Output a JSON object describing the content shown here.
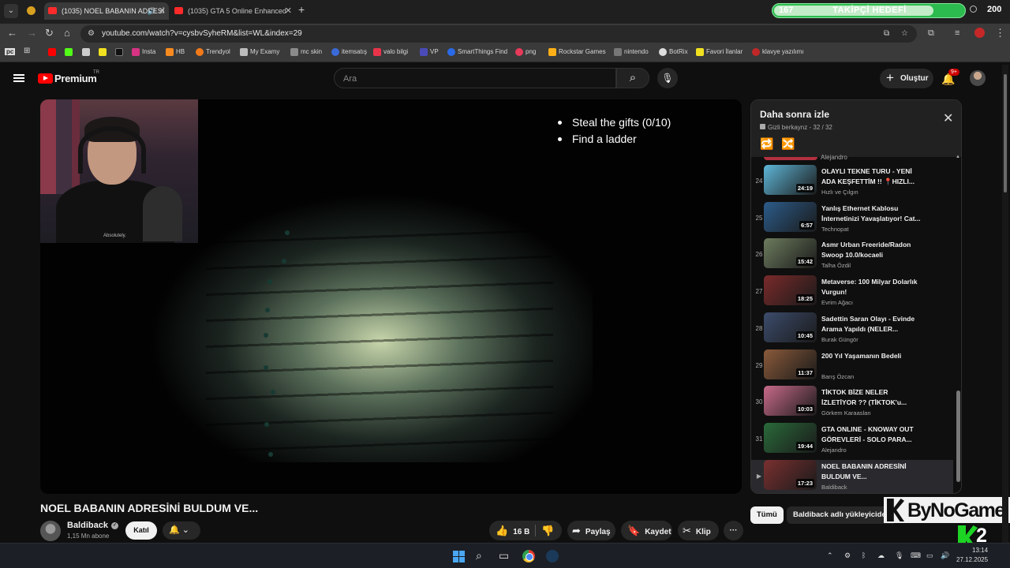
{
  "browser": {
    "tabs": [
      {
        "title": "(1035) NOEL BABANIN ADRESİ",
        "active": true
      },
      {
        "title": "(1035) GTA 5 Online Enhanced",
        "active": false
      }
    ],
    "follower_goal": {
      "current": "167",
      "title": "TAKİPÇİ HEDEFİ",
      "target": "200",
      "progress": 0.835
    },
    "url": "youtube.com/watch?v=cysbvSyheRM&list=WL&index=29",
    "bookmarks": [
      "Insta",
      "HB",
      "Trendyol",
      "My Examy",
      "mc skin",
      "itemsatış",
      "valo bilgi",
      "VP",
      "SmartThings Find",
      "png",
      "Rockstar Games",
      "nintendo",
      "BotRix",
      "Favori İlanlar",
      "klavye yazılımı"
    ]
  },
  "youtube": {
    "brand": "Premium",
    "country": "TR",
    "search_placeholder": "Ara",
    "create_label": "Oluştur",
    "notif_count": "9+"
  },
  "video": {
    "objectives": [
      "Steal the gifts   (0/10)",
      "Find a ladder"
    ],
    "webcam_shirt": "Absolutely.",
    "title": "NOEL BABANIN ADRESİNİ BULDUM VE...",
    "channel": "Baldiback",
    "subscribers": "1,15 Mn abone",
    "join_label": "Katıl",
    "likes": "16 B",
    "share_label": "Paylaş",
    "save_label": "Kaydet",
    "clip_label": "Klip",
    "more_label": "···"
  },
  "playlist": {
    "title": "Daha sonra izle",
    "privacy": "Gizli",
    "owner": "berkaynz",
    "position": "32 / 32",
    "prev_channel": "Alejandro",
    "items": [
      {
        "index": "24",
        "title": "OLAYLI TEKNE TURU - YENİ\nADA KEŞFETTİM !! 📍HIZLI...",
        "channel": "Hızlı ve Çılgın",
        "duration": "24:19",
        "color": "#5fb6d8"
      },
      {
        "index": "25",
        "title": "Yanlış Ethernet Kablosu\nİnternetinizi Yavaşlatıyor! Cat...",
        "channel": "Technopat",
        "duration": "6:57",
        "color": "#2c5c8a"
      },
      {
        "index": "26",
        "title": "Asmr Urban Freeride/Radon\nSwoop 10.0/kocaeli",
        "channel": "Talha Özdil",
        "duration": "15:42",
        "color": "#6d7c5e"
      },
      {
        "index": "27",
        "title": "Metaverse: 100 Milyar Dolarlık\nVurgun!",
        "channel": "Evrim Ağacı",
        "duration": "18:25",
        "color": "#7a2a2a"
      },
      {
        "index": "28",
        "title": "Sadettin Saran Olayı - Evinde\nArama Yapıldı (NELER...",
        "channel": "Burak Güngör",
        "duration": "10:45",
        "color": "#3c4c6c"
      },
      {
        "index": "29",
        "title": "200 Yıl Yaşamanın Bedeli",
        "channel": "Barış Özcan",
        "duration": "11:37",
        "color": "#8a5a3a"
      },
      {
        "index": "30",
        "title": "TİKTOK BİZE NELER\nİZLETİYOR ?? (TİKTOK'u...",
        "channel": "Görkem Karaaslan",
        "duration": "10:03",
        "color": "#c86a8a"
      },
      {
        "index": "31",
        "title": "GTA ONLINE - KNOWAY OUT\nGÖREVLERİ - SOLO PARA...",
        "channel": "Alejandro",
        "duration": "19:44",
        "color": "#2a6a3a"
      },
      {
        "index": "▶",
        "title": "NOEL BABANIN ADRESİNİ\nBULDUM VE...",
        "channel": "Baldiback",
        "duration": "17:23",
        "color": "#7a3030"
      }
    ]
  },
  "chips": [
    "Tümü",
    "Baldiback adlı yükleyiciden"
  ],
  "overlay": {
    "brand": "ByNoGame",
    "k_number": "2"
  },
  "taskbar": {
    "time": "13:14",
    "date": "27.12.2025"
  }
}
